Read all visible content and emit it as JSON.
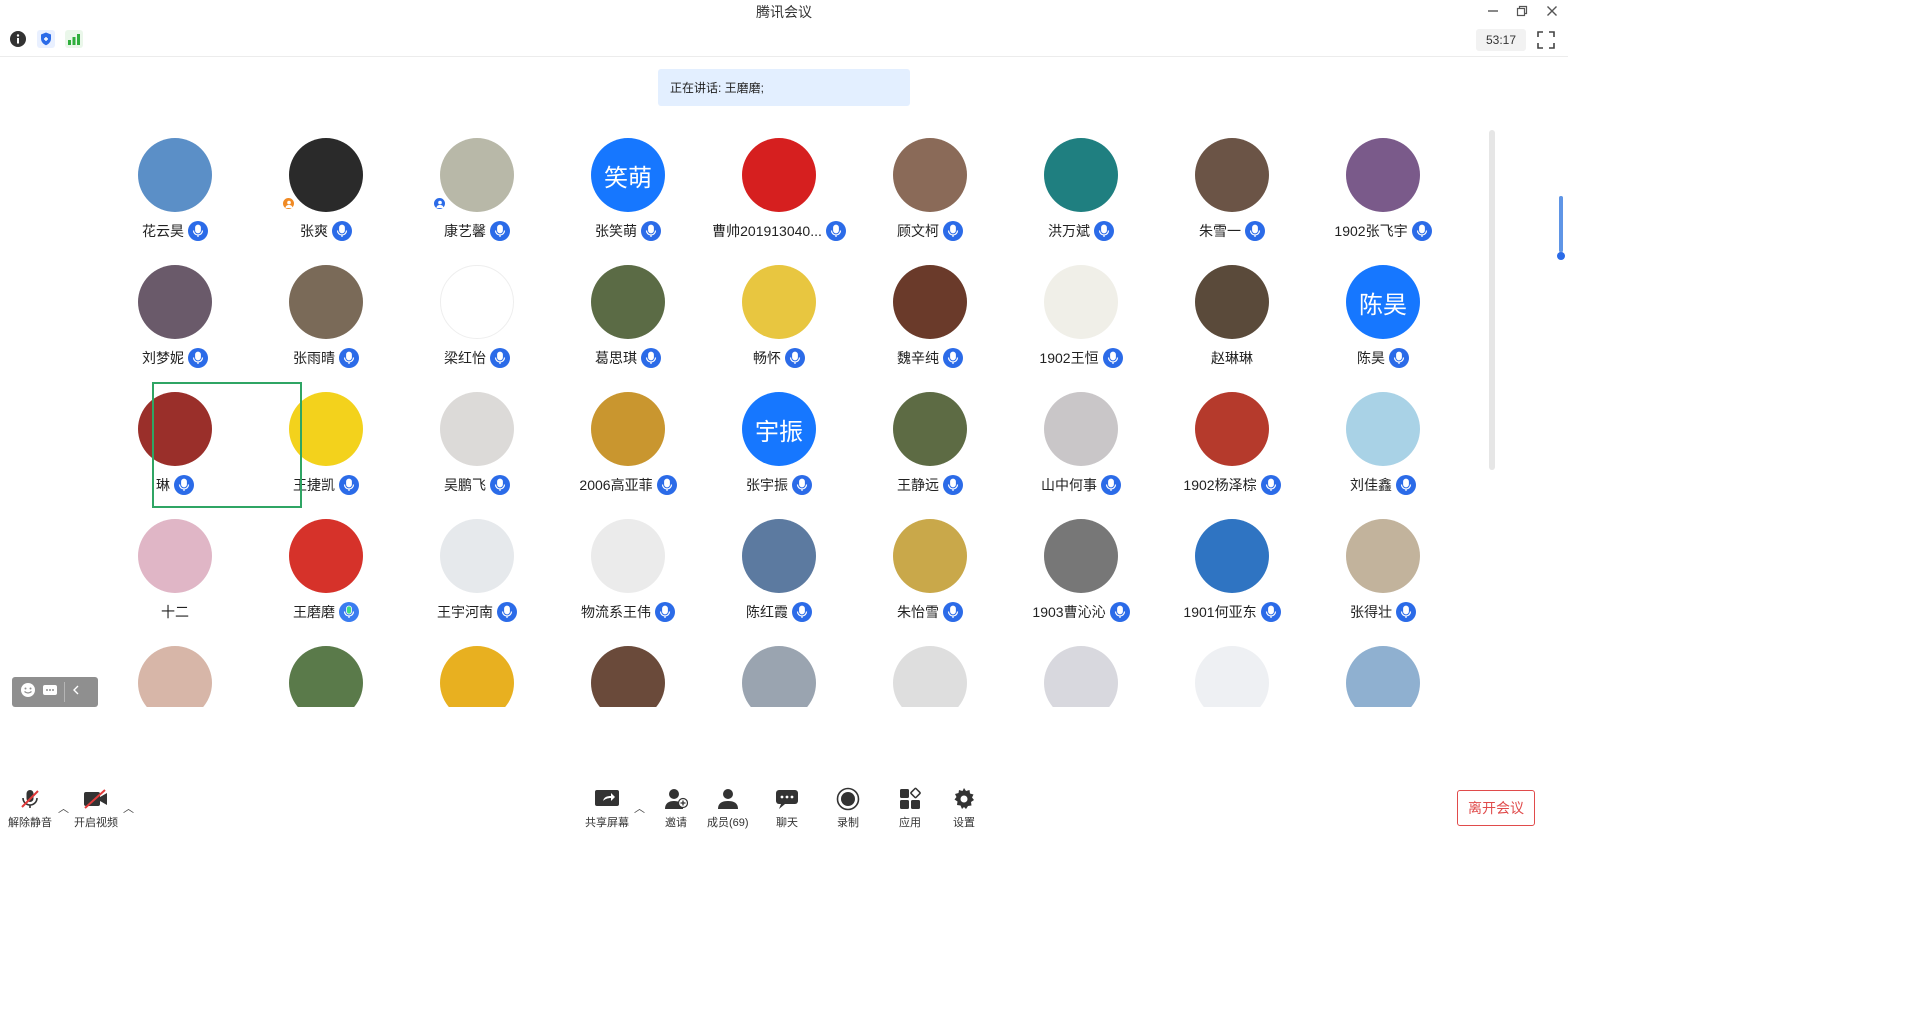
{
  "window": {
    "title": "腾讯会议",
    "minimize_icon": "minimize-icon",
    "restore_icon": "restore-icon",
    "close_icon": "close-icon"
  },
  "toolbar": {
    "info_icon": "info-icon",
    "security_icon": "shield-icon",
    "signal_icon": "signal-icon",
    "timer": "53:17",
    "fullscreen_icon": "fullscreen-icon"
  },
  "speaking": "正在讲话: 王磨磨;",
  "participants": [
    {
      "name": "花云昊",
      "avatar_color": "#5b8fc7",
      "mic": true
    },
    {
      "name": "张爽",
      "avatar_color": "#2a2a2a",
      "mic": true,
      "badge_color": "#f08a24"
    },
    {
      "name": "康艺馨",
      "avatar_color": "#b8b8a8",
      "mic": true,
      "badge_color": "#2b6be8"
    },
    {
      "name": "张笑萌",
      "avatar_text": "笑萌",
      "avatar_color": "#1677ff",
      "mic": true
    },
    {
      "name": "曹帅201913040...",
      "avatar_color": "#d61f1f",
      "mic": true
    },
    {
      "name": "顾文柯",
      "avatar_color": "#8a6a58",
      "mic": true
    },
    {
      "name": "洪万斌",
      "avatar_color": "#1f7f80",
      "mic": true
    },
    {
      "name": "朱雪一",
      "avatar_color": "#6b5446",
      "mic": true
    },
    {
      "name": "1902张飞宇",
      "avatar_color": "#7a5a8a",
      "mic": true
    },
    {
      "name": "刘梦妮",
      "avatar_color": "#6a5a6a",
      "mic": true
    },
    {
      "name": "张雨晴",
      "avatar_color": "#7a6a58",
      "mic": true
    },
    {
      "name": "梁红怡",
      "avatar_color": "#ffffff",
      "mic": true
    },
    {
      "name": "葛思琪",
      "avatar_color": "#5b6b45",
      "mic": true
    },
    {
      "name": "畅怀",
      "avatar_color": "#e8c640",
      "mic": true
    },
    {
      "name": "魏辛纯",
      "avatar_color": "#6a3a2a",
      "mic": true
    },
    {
      "name": "1902王恒",
      "avatar_color": "#f0efe8",
      "mic": true
    },
    {
      "name": "赵琳琳",
      "avatar_color": "#5a4a3a",
      "mic": false
    },
    {
      "name": "陈昊",
      "avatar_text": "陈昊",
      "avatar_color": "#1677ff",
      "mic": true
    },
    {
      "name": "琳",
      "avatar_color": "#9a2f2a",
      "mic": true
    },
    {
      "name": "王捷凯",
      "avatar_color": "#f3d21c",
      "mic": true
    },
    {
      "name": "吴鹏飞",
      "avatar_color": "#dcdad8",
      "mic": true
    },
    {
      "name": "2006高亚菲",
      "avatar_color": "#c9962f",
      "mic": true
    },
    {
      "name": "张宇振",
      "avatar_text": "宇振",
      "avatar_color": "#1677ff",
      "mic": true
    },
    {
      "name": "王静远",
      "avatar_color": "#5d6b44",
      "mic": true
    },
    {
      "name": "山中何事",
      "avatar_color": "#c9c6c8",
      "mic": true
    },
    {
      "name": "1902杨泽棕",
      "avatar_color": "#b53a2c",
      "mic": true
    },
    {
      "name": "刘佳鑫",
      "avatar_color": "#a9d2e6",
      "mic": true
    },
    {
      "name": "十二",
      "avatar_color": "#e0b6c6",
      "mic": false
    },
    {
      "name": "王磨磨",
      "avatar_color": "#d6322a",
      "mic": true,
      "speaking": true
    },
    {
      "name": "王宇河南",
      "avatar_color": "#e6e9ec",
      "mic": true
    },
    {
      "name": "物流系王伟",
      "avatar_color": "#ebebeb",
      "mic": true
    },
    {
      "name": "陈红霞",
      "avatar_color": "#5c7aa0",
      "mic": true
    },
    {
      "name": "朱怡雪",
      "avatar_color": "#c9a84a",
      "mic": true
    },
    {
      "name": "1903曹沁沁",
      "avatar_color": "#777777",
      "mic": true
    },
    {
      "name": "1901何亚东",
      "avatar_color": "#2f74c2",
      "mic": true
    },
    {
      "name": "张得壮",
      "avatar_color": "#c2b39c",
      "mic": true
    },
    {
      "name": "",
      "avatar_color": "#d7b6a8"
    },
    {
      "name": "",
      "avatar_color": "#5a7a4a"
    },
    {
      "name": "",
      "avatar_color": "#e8b020"
    },
    {
      "name": "",
      "avatar_color": "#6a4a3a"
    },
    {
      "name": "",
      "avatar_color": "#9aa4b0"
    },
    {
      "name": "",
      "avatar_color": "#dedede"
    },
    {
      "name": "",
      "avatar_color": "#d8d8de"
    },
    {
      "name": "",
      "avatar_color": "#eef0f3"
    },
    {
      "name": "",
      "avatar_color": "#8fb0d0"
    }
  ],
  "bottom_toolbar": {
    "unmute": "解除静音",
    "start_video": "开启视频",
    "share_screen": "共享屏幕",
    "invite": "邀请",
    "members": "成员(69)",
    "chat": "聊天",
    "record": "录制",
    "apps": "应用",
    "settings": "设置",
    "leave": "离开会议"
  }
}
